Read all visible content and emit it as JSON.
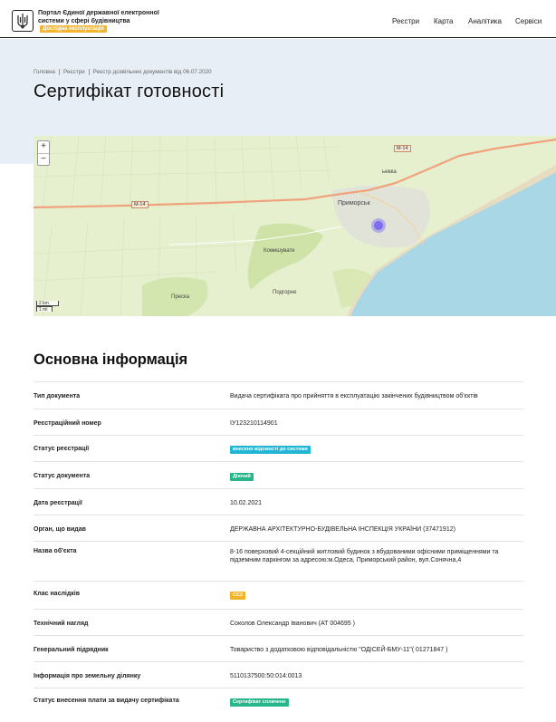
{
  "header": {
    "portal_title": "Портал Єдиної державної електронної системи у сфері будівництва",
    "beta_badge": "Дослідна експлуатація",
    "nav": [
      "Реєстри",
      "Карта",
      "Аналітика",
      "Сервіси"
    ]
  },
  "breadcrumb": [
    "Головна",
    "Реєстри",
    "Реєстр дозвільних документів від 06.07.2020"
  ],
  "page_title": "Сертифікат готовності",
  "map": {
    "zoom_in": "+",
    "zoom_out": "−",
    "scale_km": "2 km",
    "scale_mi": "1 mi",
    "road_labels": [
      "М-14",
      "М-14"
    ],
    "places": [
      "Приморськ",
      "Комишувате",
      "Преска",
      "Подгорне",
      "ьевка"
    ]
  },
  "section_title": "Основна інформація",
  "fields": [
    {
      "label": "Тип документа",
      "value": "Видача сертифіката про прийняття в експлуатацію закінчених будівництвом об'єктів"
    },
    {
      "label": "Реєстраційний номер",
      "value": "ІУ123210114901"
    },
    {
      "label": "Статус реєстрації",
      "badge": "внесено відомості до системи",
      "badge_color": "#22b6d4"
    },
    {
      "label": "Статус документа",
      "badge": "Діючий",
      "badge_color": "#27b58a"
    },
    {
      "label": "Дата реєстрації",
      "value": "10.02.2021"
    },
    {
      "label": "Орган, що видав",
      "value": "ДЕРЖАВНА АРХІТЕКТУРНО-БУДІВЕЛЬНА ІНСПЕКЦІЯ УКРАЇНИ (37471912)"
    },
    {
      "label": "Назва об'єкта",
      "value": "8-16 поверховий 4-секційний житловий будинок з вбудованими офісними приміщеннями та підземним паркінгом за адресою:м.Одеса, Приморський район, вул.Сонячна,4"
    },
    {
      "label": "Клас наслідків",
      "badge": "СС2",
      "badge_color": "#f0b429"
    },
    {
      "label": "Технічний нагляд",
      "value": "Соколов Олександр Іванович (АТ 004695 )"
    },
    {
      "label": "Генеральний підрядник",
      "value": "Товариство з додатковою відповідальністю \"ОДІСЕЙ-БМУ-11\"( 01271847 )"
    },
    {
      "label": "Інформація про земельну ділянку",
      "value": "5110137500:50:014:0013"
    },
    {
      "label": "Статус внесення плати за видачу сертифіката",
      "badge": "Сертифікат сплачено",
      "badge_color": "#27b58a"
    }
  ],
  "colors": {
    "hero_bg": "#e8eef5",
    "sea": "#a9d7e6",
    "land": "#e6efce",
    "road": "#f0a27c",
    "marker": "#7b6cf0"
  }
}
